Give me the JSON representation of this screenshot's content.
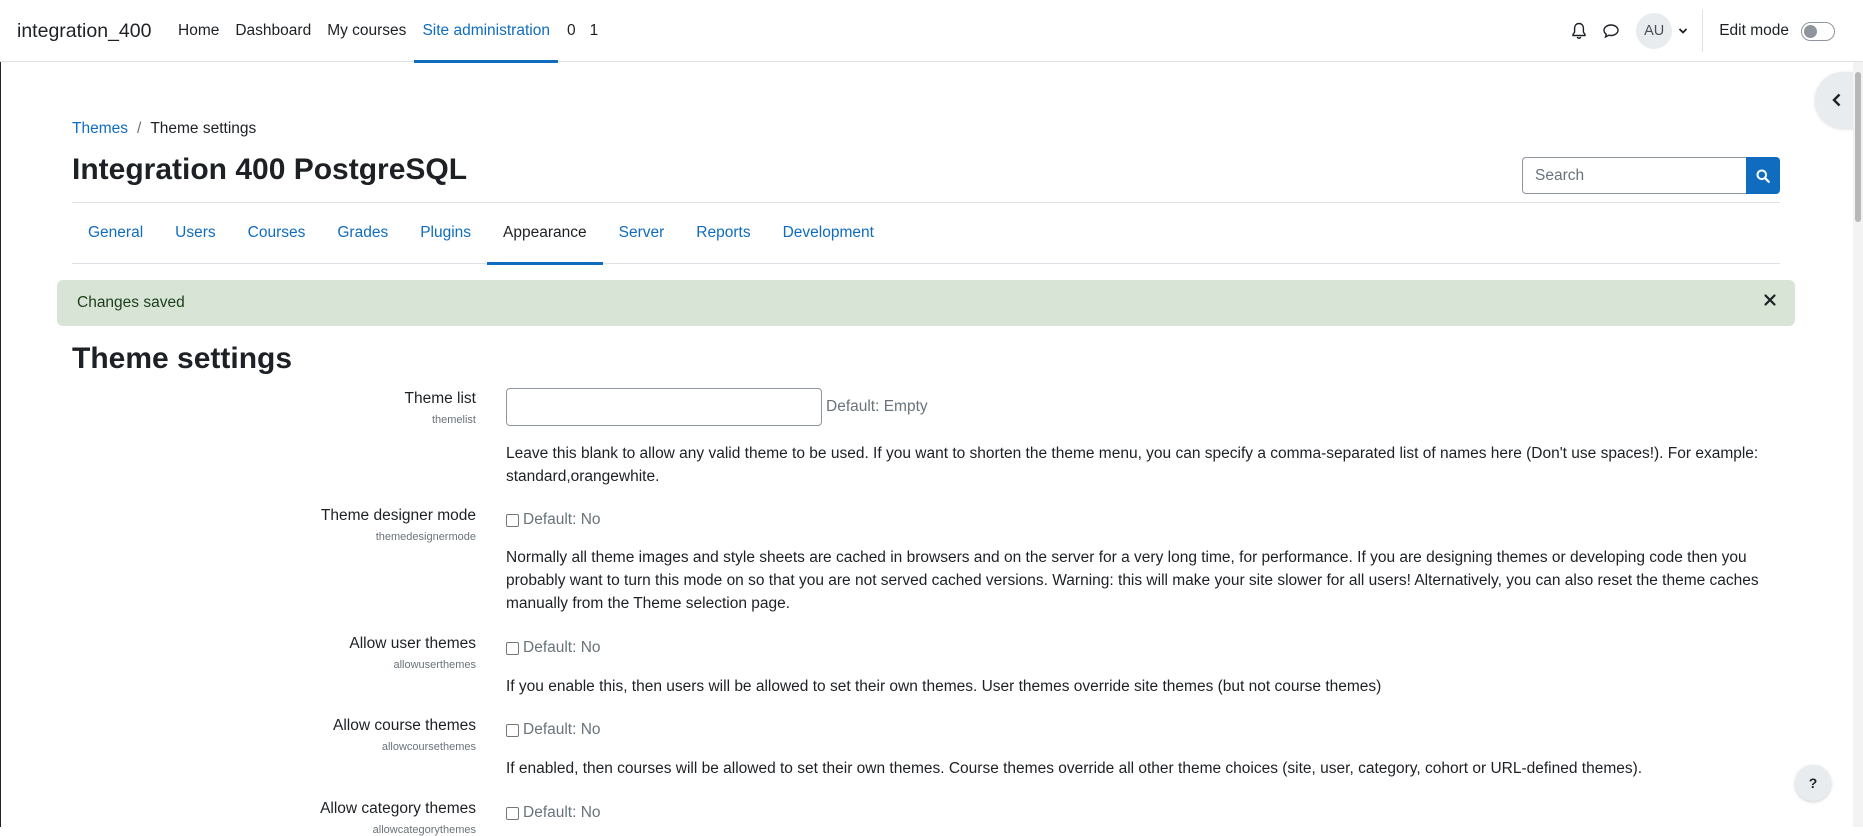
{
  "site": {
    "name": "integration_400"
  },
  "primary_nav": {
    "home": "Home",
    "dashboard": "Dashboard",
    "my_courses": "My courses",
    "site_admin": "Site administration",
    "num_0": "0",
    "num_1": "1"
  },
  "user": {
    "initials": "AU",
    "edit_mode_label": "Edit mode",
    "edit_mode_on": false
  },
  "breadcrumb": {
    "parent": "Themes",
    "separator": "/",
    "current": "Theme settings"
  },
  "header": {
    "title": "Integration 400 PostgreSQL"
  },
  "search": {
    "placeholder": "Search"
  },
  "tabs": [
    {
      "label": "General"
    },
    {
      "label": "Users"
    },
    {
      "label": "Courses"
    },
    {
      "label": "Grades"
    },
    {
      "label": "Plugins"
    },
    {
      "label": "Appearance",
      "active": true
    },
    {
      "label": "Server"
    },
    {
      "label": "Reports"
    },
    {
      "label": "Development"
    }
  ],
  "alert": {
    "message": "Changes saved",
    "color": "#d7e4d6"
  },
  "section": {
    "title": "Theme settings"
  },
  "settings": [
    {
      "name": "Theme list",
      "key": "themelist",
      "value": "",
      "default": "Default: Empty",
      "description": "Leave this blank to allow any valid theme to be used. If you want to shorten the theme menu, you can specify a comma-separated list of names here (Don't use spaces!). For example: standard,orangewhite."
    },
    {
      "name": "Theme designer mode",
      "key": "themedesignermode",
      "checked": false,
      "default": "Default: No",
      "description": "Normally all theme images and style sheets are cached in browsers and on the server for a very long time, for performance. If you are designing themes or developing code then you probably want to turn this mode on so that you are not served cached versions. Warning: this will make your site slower for all users! Alternatively, you can also reset the theme caches manually from the Theme selection page."
    },
    {
      "name": "Allow user themes",
      "key": "allowuserthemes",
      "checked": false,
      "default": "Default: No",
      "description": "If you enable this, then users will be allowed to set their own themes. User themes override site themes (but not course themes)"
    },
    {
      "name": "Allow course themes",
      "key": "allowcoursethemes",
      "checked": false,
      "default": "Default: No",
      "description": "If enabled, then courses will be allowed to set their own themes. Course themes override all other theme choices (site, user, category, cohort or URL-defined themes)."
    },
    {
      "name": "Allow category themes",
      "key": "allowcategorythemes",
      "checked": false,
      "default": "Default: No"
    }
  ],
  "help": {
    "label": "?"
  },
  "colors": {
    "primary": "#0f6cbf",
    "text": "#1d2125",
    "muted": "#6a737b"
  }
}
